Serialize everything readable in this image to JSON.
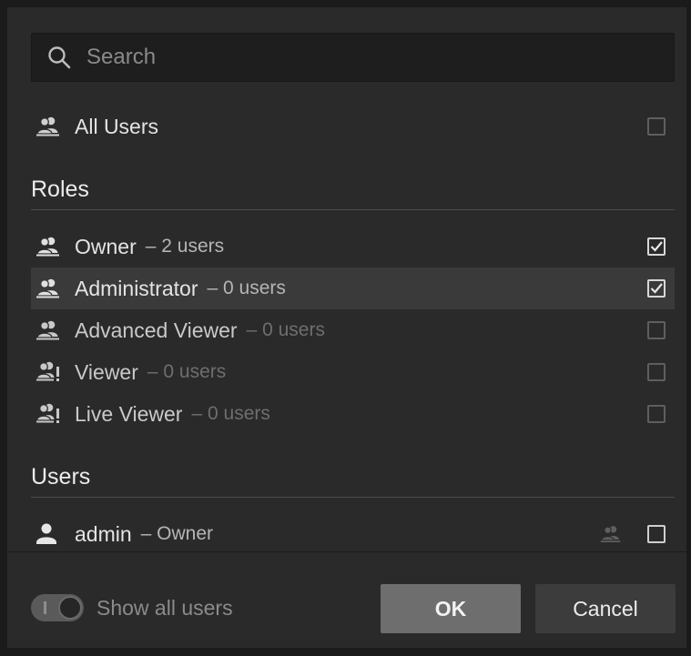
{
  "search": {
    "placeholder": "Search",
    "value": ""
  },
  "all_users": {
    "label": "All Users",
    "checked": false
  },
  "roles": {
    "title": "Roles",
    "items": [
      {
        "name": "Owner",
        "count": "– 2 users",
        "checked": true,
        "icon": "users-icon"
      },
      {
        "name": "Administrator",
        "count": "– 0 users",
        "checked": true,
        "icon": "users-icon"
      },
      {
        "name": "Advanced Viewer",
        "count": "– 0 users",
        "checked": false,
        "icon": "users-icon"
      },
      {
        "name": "Viewer",
        "count": "– 0 users",
        "checked": false,
        "icon": "users-limited-icon"
      },
      {
        "name": "Live Viewer",
        "count": "– 0 users",
        "checked": false,
        "icon": "users-limited-icon"
      }
    ]
  },
  "users": {
    "title": "Users",
    "items": [
      {
        "name": "admin",
        "role": "– Owner",
        "checked": false,
        "icon": "user-icon",
        "role_icon": "users-icon"
      }
    ]
  },
  "footer": {
    "toggle_label": "Show all users",
    "toggle_on": true,
    "ok_label": "OK",
    "cancel_label": "Cancel"
  },
  "colors": {
    "background": "#2a2a2a",
    "selected_row": "#3a3a3a",
    "ok_button": "#6e6e6e",
    "cancel_button": "#3c3c3c"
  }
}
